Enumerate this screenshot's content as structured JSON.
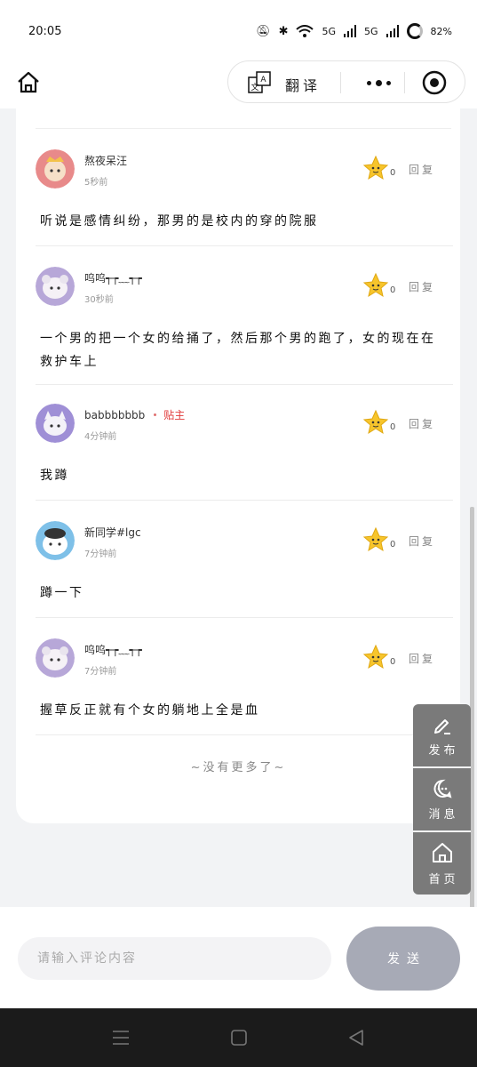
{
  "status_bar": {
    "time": "20:05",
    "network1": "5G",
    "network2": "5G",
    "battery": "82%"
  },
  "nav": {
    "translate_label": "翻译"
  },
  "comments": [
    {
      "name": "熬夜呆汪",
      "owner_badge": "",
      "time": "5秒前",
      "likes": "0",
      "reply": "回复",
      "text": "听说是感情纠纷，那男的是校内的穿的院服",
      "avatar_color": "#e88a8a"
    },
    {
      "name": "呜呜┭┮﹏┭┮",
      "owner_badge": "",
      "time": "30秒前",
      "likes": "0",
      "reply": "回复",
      "text": "一个男的把一个女的给捅了，然后那个男的跑了，女的现在在救护车上",
      "avatar_color": "#b7a7d8"
    },
    {
      "name": "babbbbbbb",
      "owner_badge": "贴主",
      "time": "4分钟前",
      "likes": "0",
      "reply": "回复",
      "text": "我蹲",
      "avatar_color": "#9f8fd6"
    },
    {
      "name": "新同学#lgc",
      "owner_badge": "",
      "time": "7分钟前",
      "likes": "0",
      "reply": "回复",
      "text": "蹲一下",
      "avatar_color": "#7ec0e8"
    },
    {
      "name": "呜呜┭┮﹏┭┮",
      "owner_badge": "",
      "time": "7分钟前",
      "likes": "0",
      "reply": "回复",
      "text": "握草反正就有个女的躺地上全是血",
      "avatar_color": "#b7a7d8"
    }
  ],
  "no_more_text": "~没有更多了~",
  "float_menu": {
    "publish": "发布",
    "messages": "消息",
    "home": "首页"
  },
  "input": {
    "placeholder": "请输入评论内容",
    "send_label": "发送"
  }
}
